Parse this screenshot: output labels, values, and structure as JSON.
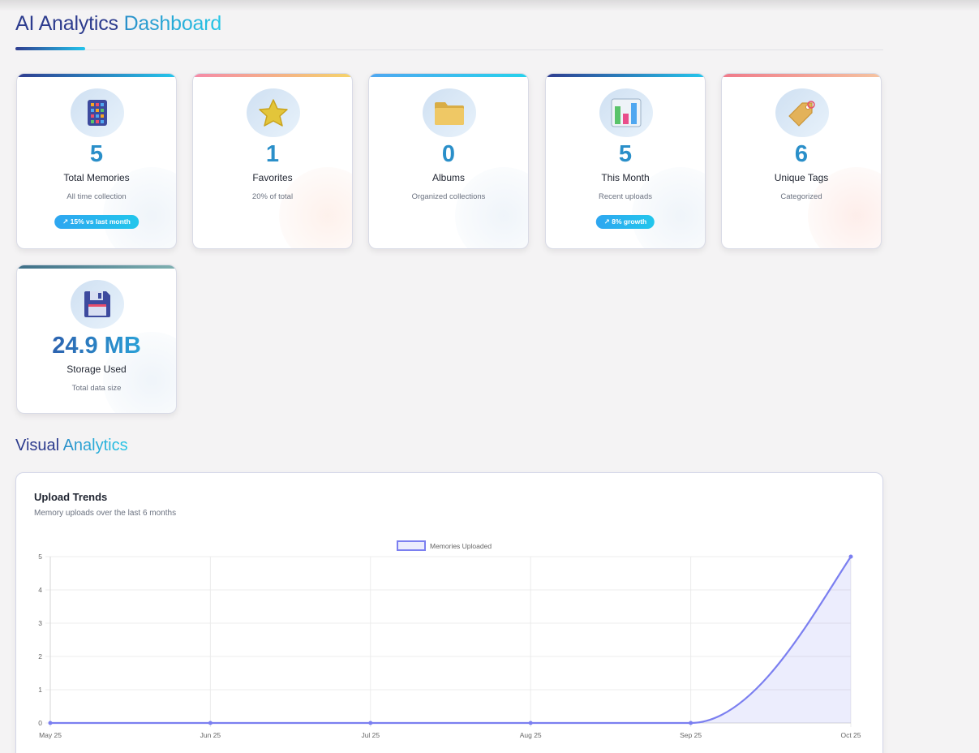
{
  "header": {
    "title_part1": "AI Analytics",
    "title_part2": "Dashboard"
  },
  "stats": [
    {
      "value": "5",
      "label": "Total Memories",
      "sub": "All time collection",
      "badge": "↗ 15% vs last month",
      "icon": "calculator-icon",
      "accent": "#2e3c8f"
    },
    {
      "value": "1",
      "label": "Favorites",
      "sub": "20% of total",
      "badge": null,
      "icon": "star-icon",
      "accent": "#f08aa0"
    },
    {
      "value": "0",
      "label": "Albums",
      "sub": "Organized collections",
      "badge": null,
      "icon": "folder-icon",
      "accent": "#4fa7f0"
    },
    {
      "value": "5",
      "label": "This Month",
      "sub": "Recent uploads",
      "badge": "↗ 8% growth",
      "icon": "bar-chart-icon",
      "accent": "#2e3c8f"
    },
    {
      "value": "6",
      "label": "Unique Tags",
      "sub": "Categorized",
      "badge": null,
      "icon": "tag-icon",
      "accent": "#f07a8a"
    },
    {
      "value": "24.9 MB",
      "label": "Storage Used",
      "sub": "Total data size",
      "badge": null,
      "icon": "floppy-disk-icon",
      "accent": "#4a7f86"
    }
  ],
  "section": {
    "title_part1": "Visual",
    "title_part2": "Analytics"
  },
  "chart_panel": {
    "title": "Upload Trends",
    "subtitle": "Memory uploads over the last 6 months"
  },
  "chart_data": {
    "type": "line",
    "categories": [
      "May 25",
      "Jun 25",
      "Jul 25",
      "Aug 25",
      "Sep 25",
      "Oct 25"
    ],
    "series": [
      {
        "name": "Memories Uploaded",
        "values": [
          0,
          0,
          0,
          0,
          0,
          5
        ],
        "color": "#7b7ff0",
        "fill": "rgba(123,127,240,0.14)"
      }
    ],
    "ylim": [
      0,
      5
    ],
    "yticks": [
      0,
      1,
      2,
      3,
      4,
      5
    ],
    "xlabel": "",
    "ylabel": "",
    "grid": true,
    "legend": "top-center",
    "smoothed": true
  }
}
